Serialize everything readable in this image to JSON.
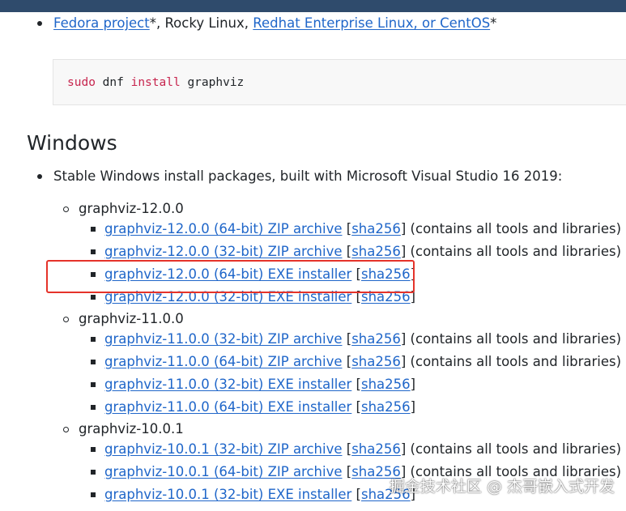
{
  "distro": {
    "fedora_link": "Fedora project",
    "middle_text": "*, Rocky Linux, ",
    "redhat_link": "Redhat Enterprise Linux, or CentOS",
    "trailing": "*"
  },
  "code": {
    "cmd": "sudo",
    "tool": "dnf",
    "verb": "install",
    "pkg": "graphviz"
  },
  "windows": {
    "heading": "Windows",
    "intro": "Stable Windows install packages, built with Microsoft Visual Studio 16 2019:",
    "groups": [
      {
        "version": "graphviz-12.0.0",
        "items": [
          {
            "label": "graphviz-12.0.0 (64-bit) ZIP archive",
            "sha": "sha256",
            "note": " (contains all tools and libraries)"
          },
          {
            "label": "graphviz-12.0.0 (32-bit) ZIP archive",
            "sha": "sha256",
            "note": " (contains all tools and libraries)"
          },
          {
            "label": "graphviz-12.0.0 (64-bit) EXE installer",
            "sha": "sha256",
            "note": ""
          },
          {
            "label": "graphviz-12.0.0 (32-bit) EXE installer",
            "sha": "sha256",
            "note": ""
          }
        ]
      },
      {
        "version": "graphviz-11.0.0",
        "items": [
          {
            "label": "graphviz-11.0.0 (32-bit) ZIP archive",
            "sha": "sha256",
            "note": " (contains all tools and libraries)"
          },
          {
            "label": "graphviz-11.0.0 (64-bit) ZIP archive",
            "sha": "sha256",
            "note": " (contains all tools and libraries)"
          },
          {
            "label": "graphviz-11.0.0 (32-bit) EXE installer",
            "sha": "sha256",
            "note": ""
          },
          {
            "label": "graphviz-11.0.0 (64-bit) EXE installer",
            "sha": "sha256",
            "note": ""
          }
        ]
      },
      {
        "version": "graphviz-10.0.1",
        "items": [
          {
            "label": "graphviz-10.0.1 (32-bit) ZIP archive",
            "sha": "sha256",
            "note": " (contains all tools and libraries)"
          },
          {
            "label": "graphviz-10.0.1 (64-bit) ZIP archive",
            "sha": "sha256",
            "note": " (contains all tools and libraries)"
          },
          {
            "label": "graphviz-10.0.1 (32-bit) EXE installer",
            "sha": "sha256",
            "note": ""
          }
        ]
      }
    ]
  },
  "watermark": "掘金技术社区 @ 杰哥嵌入式开发",
  "colors": {
    "link": "#1f66c9",
    "highlight": "#e5332a",
    "topbar": "#2f4b6c"
  }
}
